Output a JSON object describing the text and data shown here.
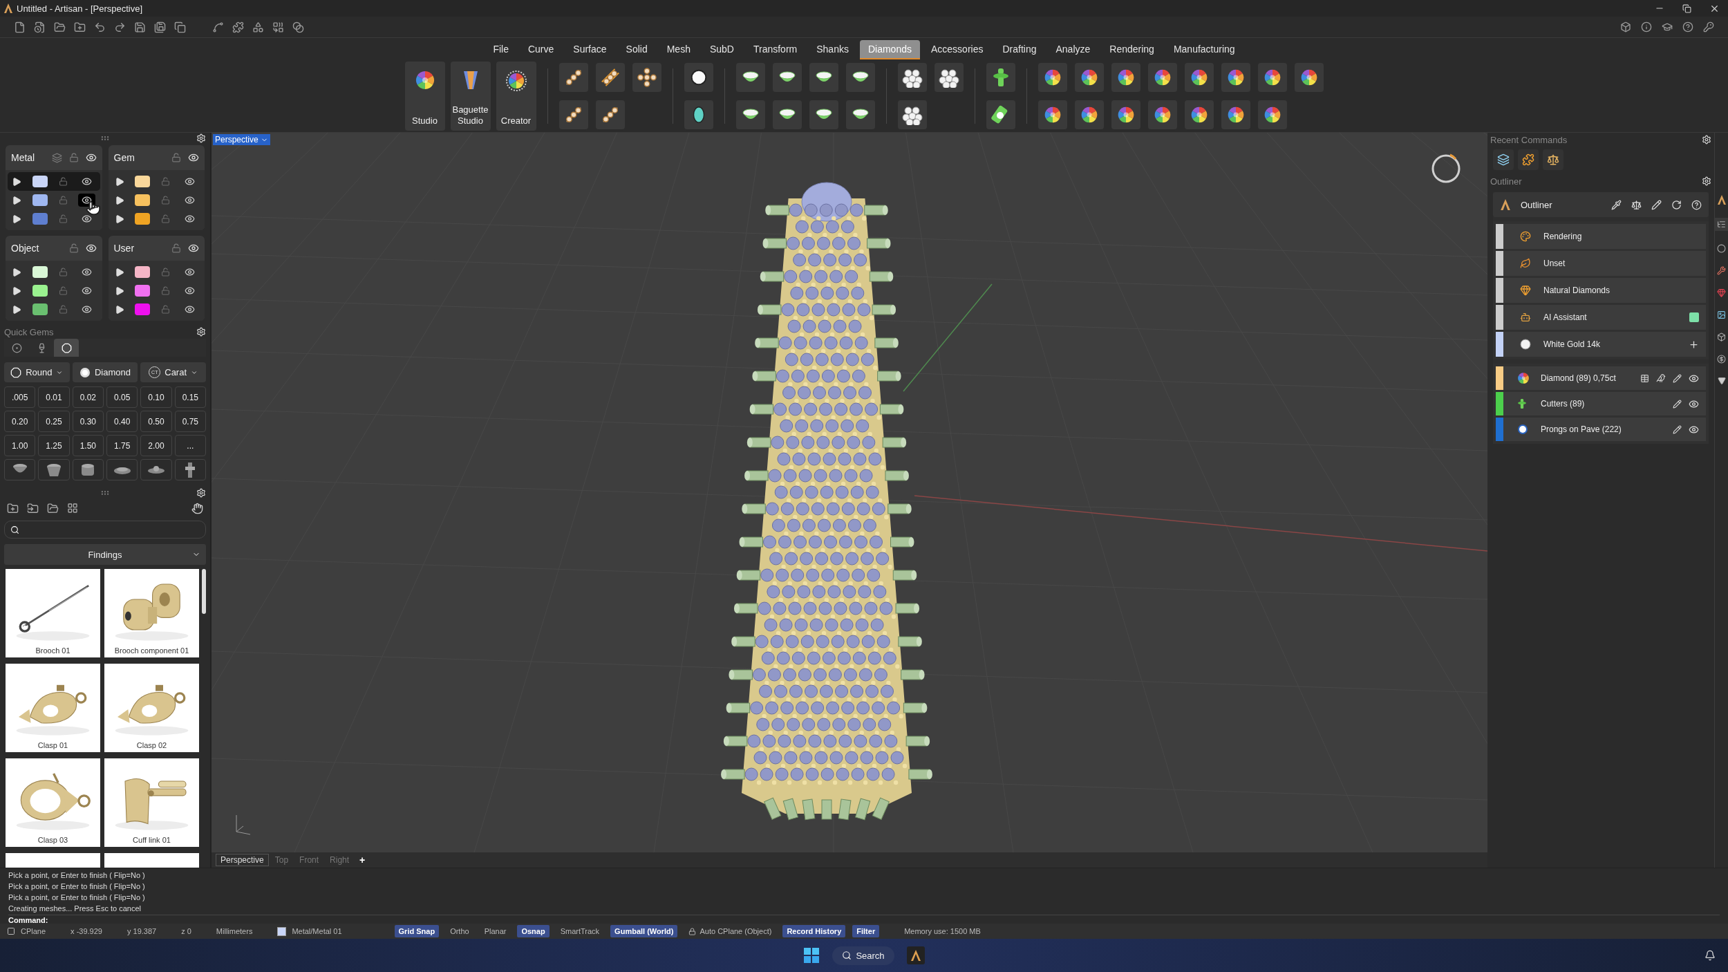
{
  "window": {
    "title": "Untitled - Artisan - [Perspective]"
  },
  "menu": [
    {
      "label": "File",
      "selected": false
    },
    {
      "label": "Curve",
      "selected": false
    },
    {
      "label": "Surface",
      "selected": false
    },
    {
      "label": "Solid",
      "selected": false
    },
    {
      "label": "Mesh",
      "selected": false
    },
    {
      "label": "SubD",
      "selected": false
    },
    {
      "label": "Transform",
      "selected": false
    },
    {
      "label": "Shanks",
      "selected": false
    },
    {
      "label": "Diamonds",
      "selected": true
    },
    {
      "label": "Accessories",
      "selected": false
    },
    {
      "label": "Drafting",
      "selected": false
    },
    {
      "label": "Analyze",
      "selected": false
    },
    {
      "label": "Rendering",
      "selected": false
    },
    {
      "label": "Manufacturing",
      "selected": false
    }
  ],
  "ribbon": {
    "big_buttons": [
      "Studio",
      "Baguette Studio",
      "Creator"
    ]
  },
  "layers": [
    {
      "name": "Metal",
      "rows": [
        {
          "color": "#c9d5f7",
          "selected": true,
          "hover": false
        },
        {
          "color": "#9fb7f0",
          "selected": false,
          "hover": true
        },
        {
          "color": "#5f7fd0",
          "selected": false,
          "hover": false
        }
      ]
    },
    {
      "name": "Gem",
      "rows": [
        {
          "color": "#f9d79a",
          "selected": false,
          "hover": false
        },
        {
          "color": "#f7c15e",
          "selected": false,
          "hover": false
        },
        {
          "color": "#f0a423",
          "selected": false,
          "hover": false
        }
      ]
    },
    {
      "name": "Object",
      "rows": [
        {
          "color": "#d9f7d6",
          "selected": false,
          "hover": false
        },
        {
          "color": "#9af28f",
          "selected": false,
          "hover": false
        },
        {
          "color": "#6ac070",
          "selected": false,
          "hover": false
        }
      ]
    },
    {
      "name": "User",
      "rows": [
        {
          "color": "#f5b5c6",
          "selected": false,
          "hover": false
        },
        {
          "color": "#f070f0",
          "selected": false,
          "hover": false
        },
        {
          "color": "#ee10ee",
          "selected": false,
          "hover": false
        }
      ]
    }
  ],
  "quick_gems": {
    "title": "Quick Gems",
    "tabs": [
      {
        "selected": false
      },
      {
        "selected": false
      },
      {
        "selected": true
      }
    ],
    "shape": "Round",
    "material": "Diamond",
    "unit_badge": "CT",
    "unit": "Carat",
    "sizes": [
      ".005",
      "0.01",
      "0.02",
      "0.05",
      "0.10",
      "0.15",
      "0.20",
      "0.25",
      "0.30",
      "0.40",
      "0.50",
      "0.75",
      "1.00",
      "1.25",
      "1.50",
      "1.75",
      "2.00",
      "..."
    ]
  },
  "library": {
    "category": "Findings",
    "items": [
      {
        "label": "Brooch 01",
        "kind": "pin"
      },
      {
        "label": "Brooch component 01",
        "kind": "bead"
      },
      {
        "label": "Clasp 01",
        "kind": "clasp"
      },
      {
        "label": "Clasp 02",
        "kind": "clasp"
      },
      {
        "label": "Clasp 03",
        "kind": "ring"
      },
      {
        "label": "Cuff link 01",
        "kind": "cufflink"
      },
      {
        "kind": "blank"
      },
      {
        "kind": "blank"
      }
    ]
  },
  "viewport": {
    "label": "Perspective",
    "tabs": [
      {
        "label": "Perspective",
        "selected": true
      },
      {
        "label": "Top",
        "selected": false
      },
      {
        "label": "Front",
        "selected": false
      },
      {
        "label": "Right",
        "selected": false
      }
    ],
    "add_tab": "+"
  },
  "recent_commands": {
    "title": "Recent Commands"
  },
  "outliner": {
    "title": "Outliner",
    "header": "Outliner",
    "layers": [
      {
        "label": "Rendering",
        "kind": "palette",
        "color": "#cccccc",
        "status": false,
        "addable": false
      },
      {
        "label": "Unset",
        "kind": "leaf",
        "color": "#cccccc",
        "status": false,
        "addable": false
      },
      {
        "label": "Natural Diamonds",
        "kind": "gem",
        "color": "#cccccc",
        "status": false,
        "addable": false
      },
      {
        "label": "AI Assistant",
        "kind": "robot",
        "color": "#cccccc",
        "status": true,
        "addable": false
      },
      {
        "label": "White Gold 14k",
        "kind": "metal",
        "color": "#c3d2f6",
        "status": false,
        "addable": true
      }
    ],
    "objects": [
      {
        "label": "Diamond (89) 0,75ct",
        "kind": "gem",
        "color": "#f8cc85"
      },
      {
        "label": "Cutters (89)",
        "kind": "cutter",
        "color": "#4ccf4c"
      },
      {
        "label": "Prongs on Pave (222)",
        "kind": "prong",
        "color": "#1f6fd0"
      }
    ]
  },
  "command_history": [
    "Pick a point, or Enter to finish ( Flip=No )",
    "Pick a point, or Enter to finish ( Flip=No )",
    "Pick a point, or Enter to finish ( Flip=No )",
    "Creating meshes... Press Esc to cancel"
  ],
  "command_prompt": "Command:",
  "status_bar": {
    "cplane": "CPlane",
    "x": "x -39.929",
    "y": "y 19.387",
    "z": "z 0",
    "units": "Millimeters",
    "layer": {
      "name": "Metal/Metal 01",
      "color": "#c9d5f7"
    },
    "toggles": [
      {
        "label": "Grid Snap",
        "on": true,
        "kind": "toggle"
      },
      {
        "label": "Ortho",
        "on": false,
        "kind": "toggle"
      },
      {
        "label": "Planar",
        "on": false,
        "kind": "toggle"
      },
      {
        "label": "Osnap",
        "on": true,
        "kind": "toggle"
      },
      {
        "label": "SmartTrack",
        "on": false,
        "kind": "toggle"
      },
      {
        "label": "Gumball (World)",
        "on": true,
        "kind": "toggle"
      },
      {
        "label": "Auto CPlane (Object)",
        "on": false,
        "kind": "lock"
      },
      {
        "label": "Record History",
        "on": true,
        "kind": "toggle"
      },
      {
        "label": "Filter",
        "on": true,
        "kind": "toggle"
      }
    ],
    "memory": "Memory use: 1500 MB"
  },
  "taskbar": {
    "search": "Search"
  }
}
